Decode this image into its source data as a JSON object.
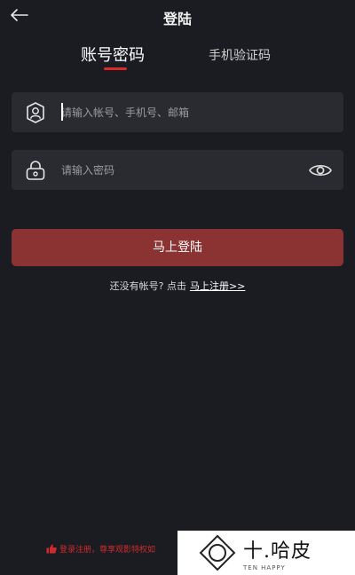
{
  "header": {
    "back_icon": "arrow-left-icon",
    "title": "登陆"
  },
  "tabs": [
    {
      "label": "账号密码",
      "active": true
    },
    {
      "label": "手机验证码",
      "active": false
    }
  ],
  "form": {
    "account": {
      "placeholder": "请输入帐号、手机号、邮箱",
      "value": "",
      "icon": "user-shield-icon"
    },
    "password": {
      "placeholder": "请输入密码",
      "value": "",
      "icon": "lock-icon",
      "toggle_icon": "eye-icon"
    }
  },
  "login_button": "马上登陆",
  "register": {
    "prompt": "还没有帐号? 点击",
    "link": "马上注册>>"
  },
  "bottom_note": "登录注册，尊享观影特权如",
  "watermark": {
    "cn": "十.哈皮",
    "en": "TEN HAPPY"
  },
  "colors": {
    "background": "#1b1c22",
    "field": "#2a2b30",
    "accent": "#d92b2b",
    "button": "#8b3232"
  }
}
